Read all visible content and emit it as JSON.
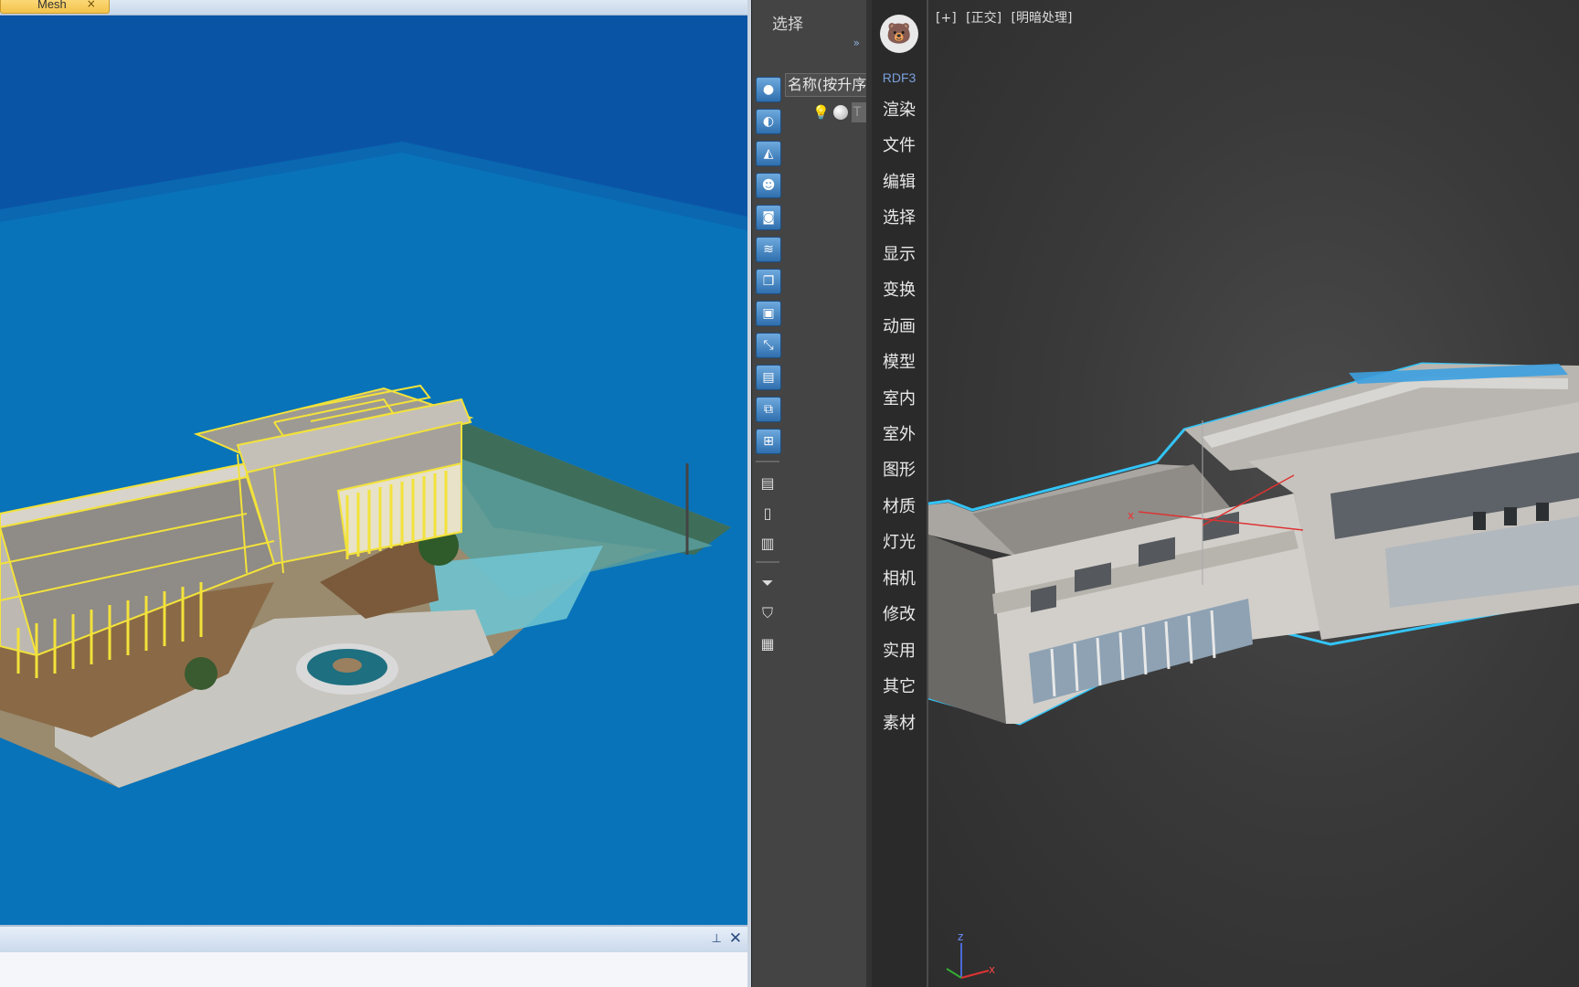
{
  "left_window": {
    "tab_label": "Mesh",
    "tab_close": "×",
    "pin_icon": "pin-icon",
    "close": "✕"
  },
  "command_panel": {
    "title": "选择",
    "expand_glyph": "»",
    "name_column_header": "名称(按升序",
    "row_name": "T"
  },
  "rdf_menu": {
    "plugin_name": "RDF3",
    "items": [
      "渲染",
      "文件",
      "编辑",
      "选择",
      "显示",
      "变换",
      "动画",
      "模型",
      "室内",
      "室外",
      "图形",
      "材质",
      "灯光",
      "相机",
      "修改",
      "实用",
      "其它",
      "素材"
    ]
  },
  "viewport": {
    "labels": [
      "[+]",
      "[正交]",
      "[明暗处理]"
    ],
    "gizmo_axes": [
      "z",
      "x"
    ]
  },
  "colors": {
    "scene_sky": "#0a54a6",
    "scene_ground": "#0873b9",
    "selection_yellow": "#f3e23a",
    "selection_cyan": "#33c4f7"
  }
}
